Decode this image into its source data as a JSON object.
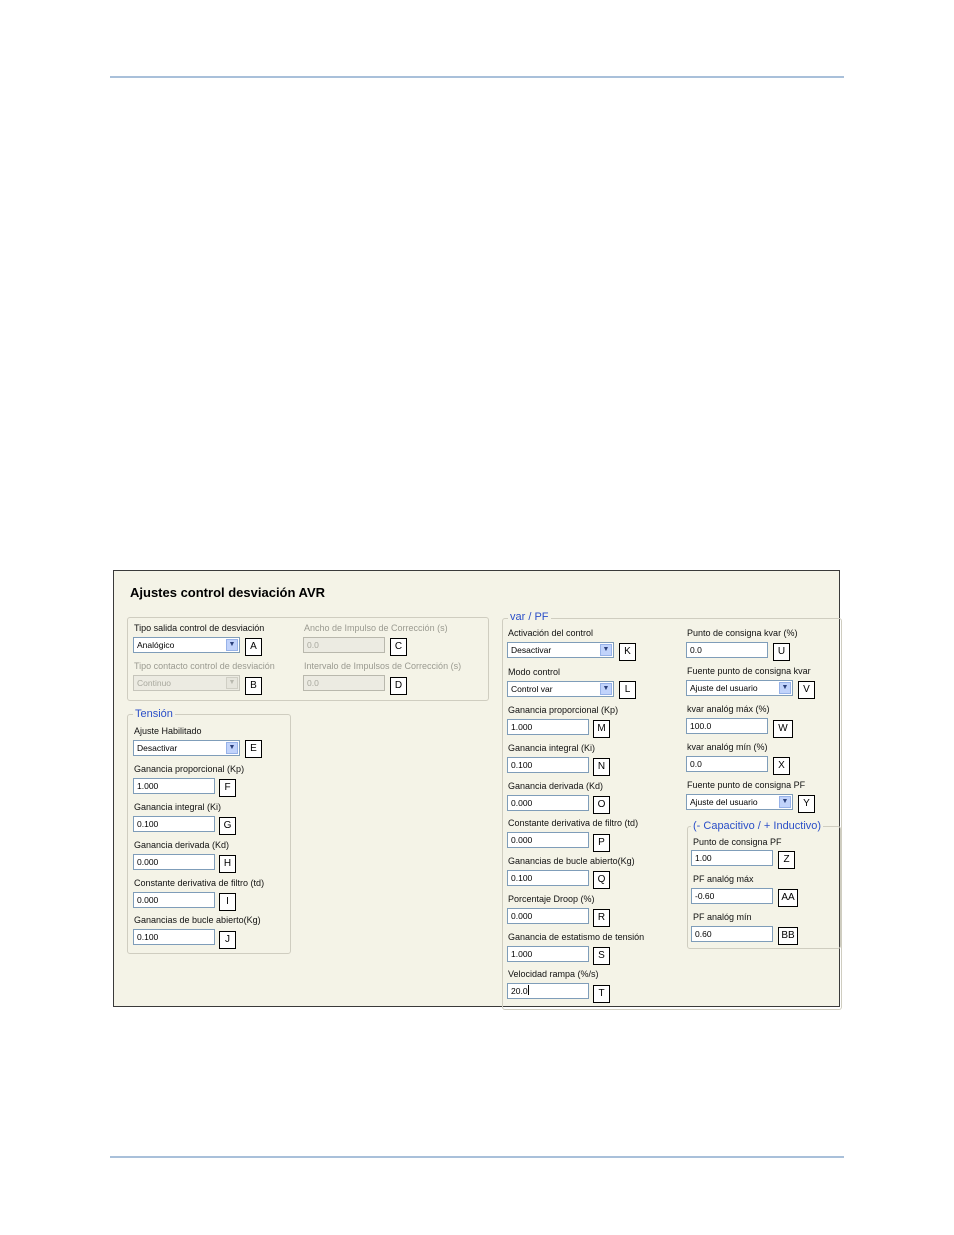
{
  "dialog": {
    "title": "Ajustes control desviación AVR",
    "top": {
      "tipo_salida": {
        "label": "Tipo salida control de desviación",
        "value": "Analógico",
        "tag": "A"
      },
      "tipo_contacto": {
        "label": "Tipo contacto control de desviación",
        "value": "Continuo",
        "tag": "B"
      },
      "ancho_impulso": {
        "label": "Ancho de Impulso de Corrección (s)",
        "value": "0.0",
        "tag": "C"
      },
      "intervalo_impulsos": {
        "label": "Intervalo de Impulsos de Corrección (s)",
        "value": "0.0",
        "tag": "D"
      }
    },
    "tension": {
      "legend": "Tensión",
      "ajuste_habilitado": {
        "label": "Ajuste Habilitado",
        "value": "Desactivar",
        "tag": "E"
      },
      "ganancia_proporcional": {
        "label": "Ganancia proporcional (Kp)",
        "value": "1.000",
        "tag": "F"
      },
      "ganancia_integral": {
        "label": "Ganancia integral (Ki)",
        "value": "0.100",
        "tag": "G"
      },
      "ganancia_derivada": {
        "label": "Ganancia derivada (Kd)",
        "value": "0.000",
        "tag": "H"
      },
      "constante_filtro": {
        "label": "Constante derivativa de filtro (td)",
        "value": "0.000",
        "tag": "I"
      },
      "bucle_abierto": {
        "label": "Ganancias de bucle abierto(Kg)",
        "value": "0.100",
        "tag": "J"
      }
    },
    "varpf": {
      "legend": "var / PF",
      "activacion": {
        "label": "Activación del control",
        "value": "Desactivar",
        "tag": "K"
      },
      "modo": {
        "label": "Modo control",
        "value": "Control var",
        "tag": "L"
      },
      "ganancia_proporcional": {
        "label": "Ganancia proporcional (Kp)",
        "value": "1.000",
        "tag": "M"
      },
      "ganancia_integral": {
        "label": "Ganancia integral (Ki)",
        "value": "0.100",
        "tag": "N"
      },
      "ganancia_derivada": {
        "label": "Ganancia derivada (Kd)",
        "value": "0.000",
        "tag": "O"
      },
      "constante_filtro": {
        "label": "Constante derivativa de filtro (td)",
        "value": "0.000",
        "tag": "P"
      },
      "bucle_abierto": {
        "label": "Ganancias de bucle abierto(Kg)",
        "value": "0.100",
        "tag": "Q"
      },
      "droop": {
        "label": "Porcentaje Droop (%)",
        "value": "0.000",
        "tag": "R"
      },
      "estatismo": {
        "label": "Ganancia de estatismo de tensión",
        "value": "1.000",
        "tag": "S"
      },
      "rampa": {
        "label": "Velocidad rampa (%/s)",
        "value": "20.0",
        "tag": "T"
      },
      "consigna_kvar": {
        "label": "Punto de consigna kvar (%)",
        "value": "0.0",
        "tag": "U"
      },
      "fuente_kvar": {
        "label": "Fuente punto de consigna kvar",
        "value": "Ajuste del usuario",
        "tag": "V"
      },
      "kvar_max": {
        "label": "kvar analóg máx (%)",
        "value": "100.0",
        "tag": "W"
      },
      "kvar_min": {
        "label": "kvar analóg mín (%)",
        "value": "0.0",
        "tag": "X"
      },
      "fuente_pf": {
        "label": "Fuente punto de consigna PF",
        "value": "Ajuste del usuario",
        "tag": "Y"
      }
    },
    "capind": {
      "legend": "(- Capacitivo / + Inductivo)",
      "consigna_pf": {
        "label": "Punto de consigna PF",
        "value": "1.00",
        "tag": "Z"
      },
      "pf_max": {
        "label": "PF analóg máx",
        "value": "-0.60",
        "tag": "AA"
      },
      "pf_min": {
        "label": "PF analóg mín",
        "value": "0.60",
        "tag": "BB"
      }
    }
  }
}
